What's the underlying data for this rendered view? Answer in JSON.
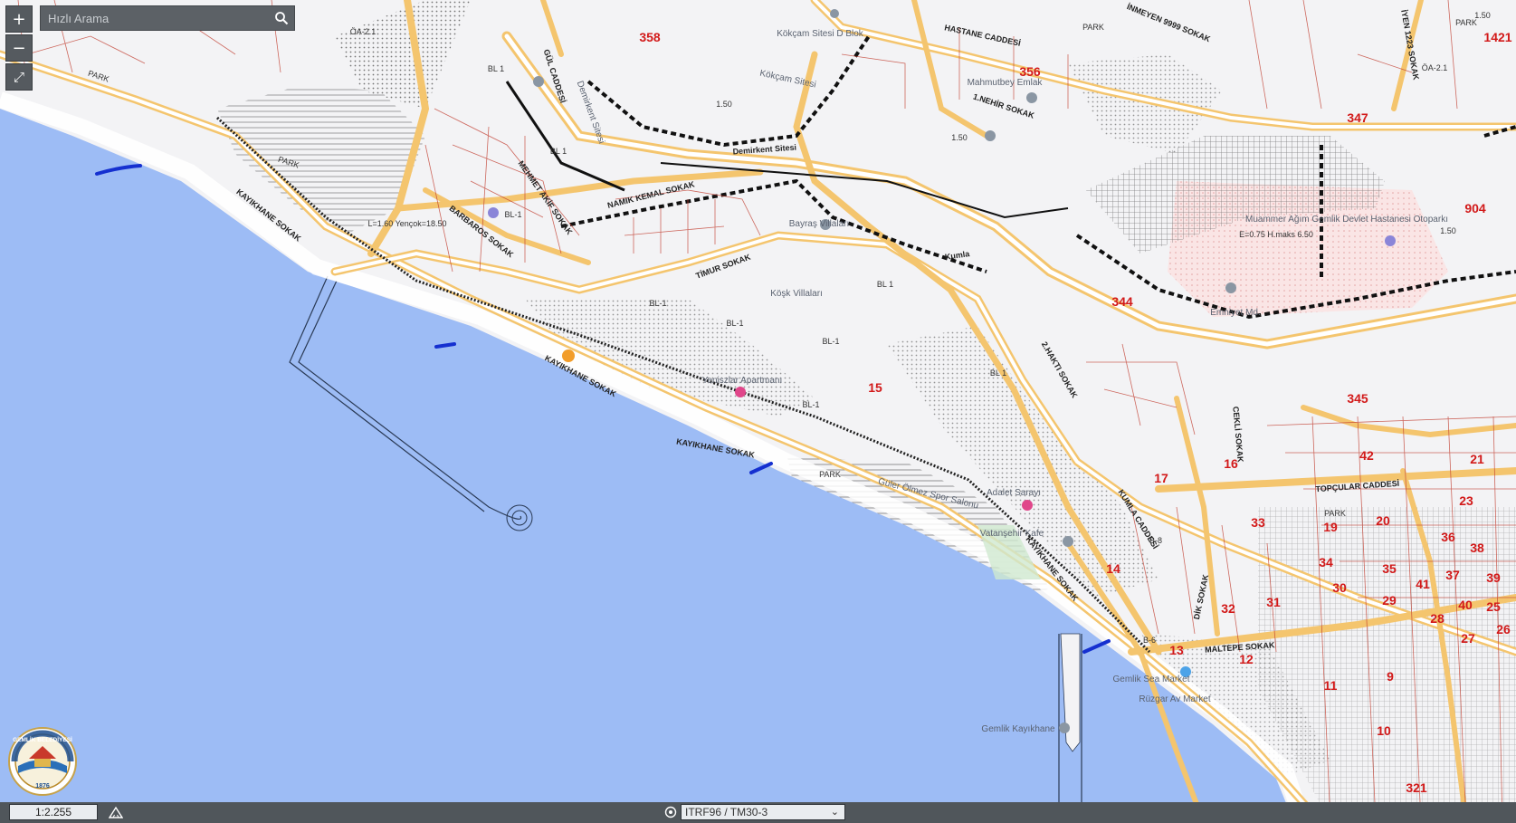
{
  "controls": {
    "zoom_in": "+",
    "zoom_out": "−",
    "fullscreen": "⤢"
  },
  "search": {
    "placeholder": "Hızlı Arama"
  },
  "bottom": {
    "scale": "1:2.255",
    "projection": "ITRF96 / TM30-3"
  },
  "logo": {
    "text_top": "GEMLİK BELEDİYESİ",
    "year": "1876"
  },
  "colors": {
    "sea": "#9dbcf5",
    "road": "#f4c56e",
    "parcel": "#c0392b",
    "shore_mark": "#1530d0",
    "toolbar": "#50565b"
  },
  "map": {
    "streets": [
      "HASTANE CADDESİ",
      "GÜL CADDESİ",
      "1.NEHİR SOKAK",
      "NAMIK KEMAL SOKAK",
      "MEHMET AKİF SOKAK",
      "BARBAROS SOKAK",
      "KAYIKHANE SOKAK",
      "KAYIKHANE SOKAK",
      "KAYIKHANE SOKAK",
      "KAYIKHANE SOKAK",
      "TİMUR SOKAK",
      "TOPÇULAR CADDESİ",
      "KUMLA CADDESİ",
      "2.HAKTI SOKAK",
      "MALTEPE SOKAK",
      "CEKLİ SOKAK",
      "DİK SOKAK",
      "İNMEYEN 9999 SOKAK",
      "İYEN 1223 SOKAK",
      "Demirkent Sitesi",
      "Kumla"
    ],
    "places": [
      "Kökçam Sitesi D Blok",
      "Kökçam Sitesi",
      "Demirkent Sitesi",
      "Mahmutbey Emlak",
      "Bayraş Villaları",
      "Köşk Villaları",
      "Muammer Ağım Gemlik Devlet Hastanesi Otoparkı",
      "Emniyet Md.",
      "Adalet Sarayı",
      "Güler Ölmez Spor Salonu",
      "Gemlik Kayıkhane",
      "Gemlik Sea Market",
      "Rüzgar Av Market",
      "Yeniszlar Apartmanı",
      "Vatanşehir Kafe"
    ],
    "blocks": [
      "358",
      "356",
      "347",
      "904",
      "344",
      "345",
      "42",
      "21",
      "15",
      "17",
      "16",
      "33",
      "19",
      "20",
      "23",
      "36",
      "38",
      "34",
      "35",
      "37",
      "39",
      "41",
      "30",
      "31",
      "32",
      "29",
      "28",
      "40",
      "25",
      "27",
      "26",
      "14",
      "13",
      "12",
      "11",
      "9",
      "10",
      "321",
      "1421"
    ],
    "zones": [
      "BL 1",
      "BL-1",
      "BL 1",
      "BL-1",
      "BL-1",
      "BL-1",
      "BL 1",
      "BL 1",
      "BL-1",
      "B-8",
      "B-6",
      "PARK",
      "PARK",
      "PARK",
      "PARK",
      "PARK",
      "ÖA-2.1",
      "ÖA-2.1",
      "1.50",
      "1.50",
      "1.50",
      "1.50",
      "E=0.75 H.maks 6.50",
      "L=1.60 Yençok=18.50",
      "PARK"
    ]
  }
}
